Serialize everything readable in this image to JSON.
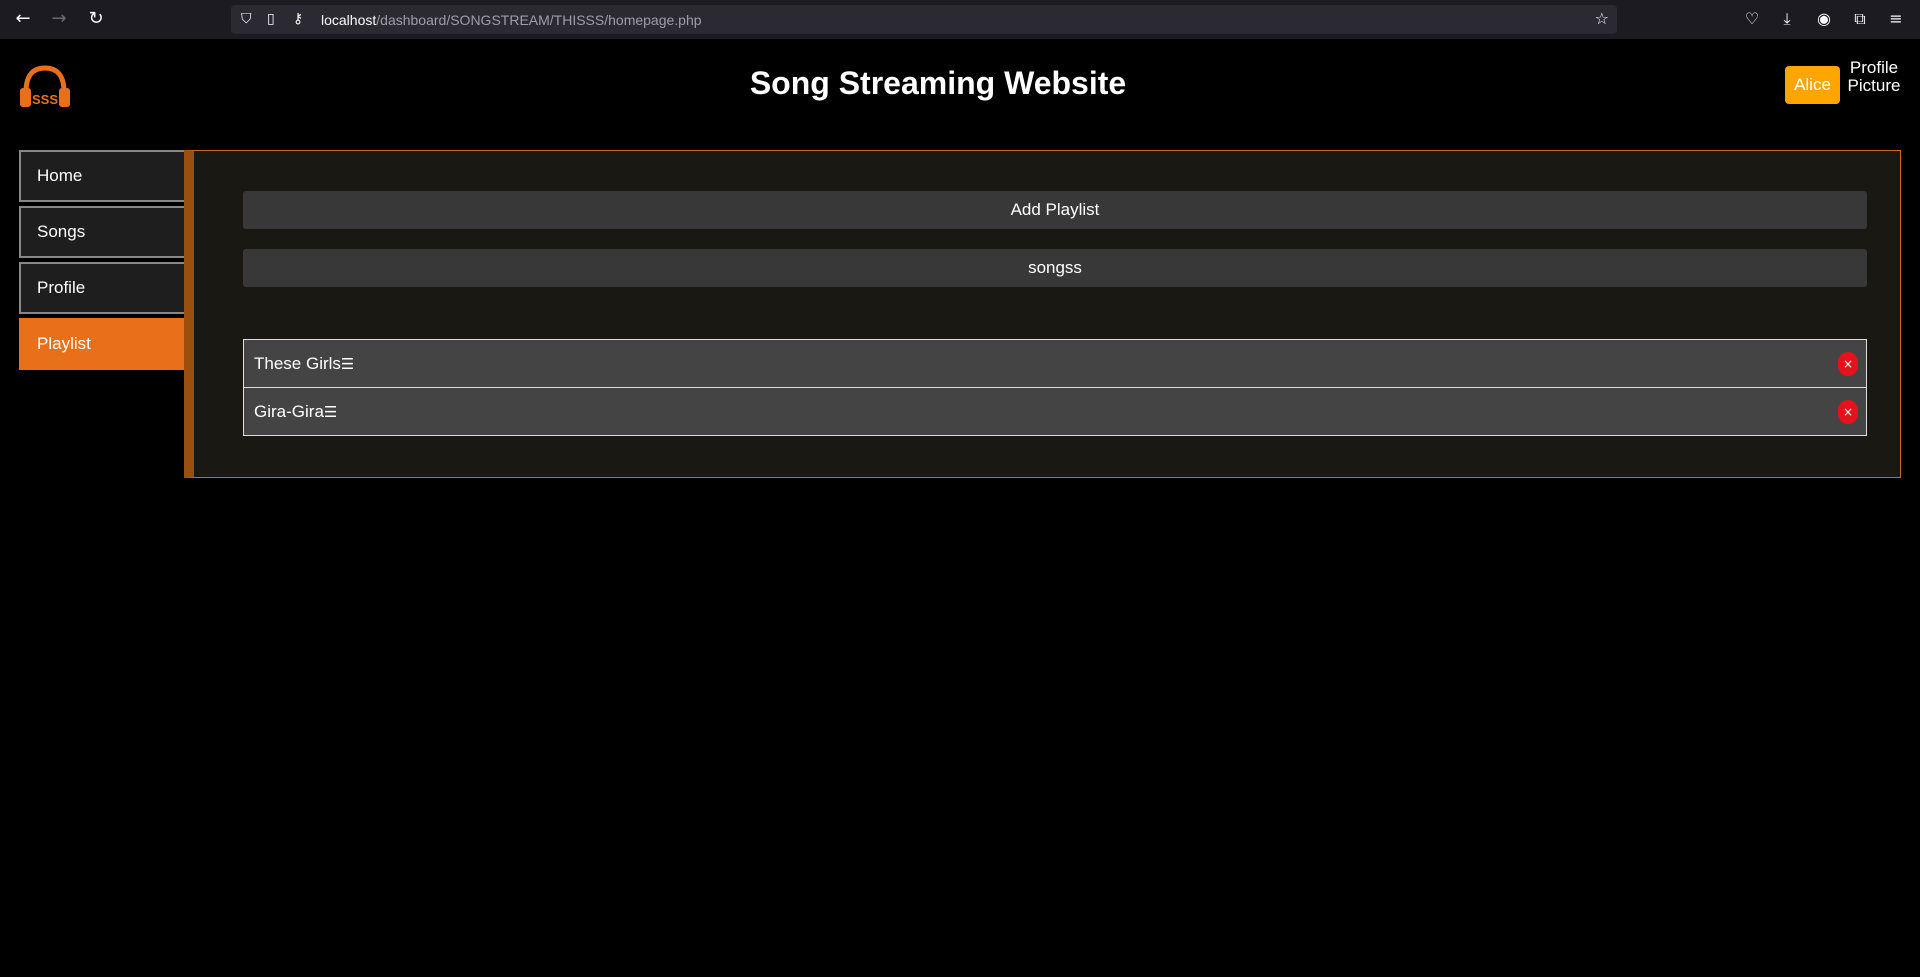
{
  "browser": {
    "url_host": "localhost",
    "url_path": "/dashboard/SONGSTREAM/THISSS/homepage.php"
  },
  "header": {
    "logo_text": "SSS",
    "title": "Song Streaming Website",
    "user_label": "Alice",
    "profile_picture_alt": "Profile Picture"
  },
  "sidebar": {
    "items": [
      {
        "label": "Home"
      },
      {
        "label": "Songs"
      },
      {
        "label": "Profile"
      },
      {
        "label": "Playlist"
      }
    ],
    "active": "Playlist"
  },
  "main": {
    "add_playlist_label": "Add Playlist",
    "playlist_name": "songss",
    "songs": [
      {
        "title": "These Girls",
        "handle": "☰",
        "remove": "×"
      },
      {
        "title": "Gira-Gira",
        "handle": "☰",
        "remove": "×"
      }
    ]
  },
  "colors": {
    "accent": "#e8701a",
    "user_button": "#ffa500",
    "delete": "#e3121b"
  }
}
